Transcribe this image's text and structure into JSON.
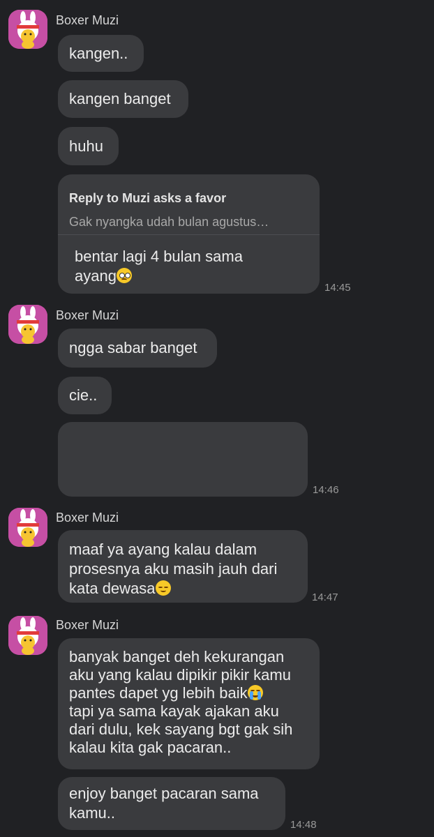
{
  "sender_name": "Boxer Muzi",
  "messages": {
    "m1": "kangen..",
    "m2": "kangen banget",
    "m3": "huhu",
    "reply_title": "Reply to Muzi asks a favor",
    "reply_snippet": "Gak nyangka udah bulan agustus…",
    "m4": "bentar lagi 4 bulan sama\nayang",
    "m5": "ngga sabar banget",
    "m6": "cie..",
    "m8": "maaf ya ayang kalau dalam\nprosesnya aku masih jauh dari\nkata dewasa",
    "m9": "banyak banget deh kekurangan\naku yang kalau dipikir pikir kamu\npantes dapet yg lebih baik",
    "m9b": "tapi ya sama kayak ajakan aku\ndari dulu, kek sayang bgt gak sih\nkalau kita gak pacaran..",
    "m10": "enjoy banget pacaran sama\nkamu.."
  },
  "times": {
    "t1": "14:45",
    "t2": "14:46",
    "t3": "14:47",
    "t4": "14:48"
  },
  "emojis": {
    "pleading": "pleading-face-icon",
    "disappointed": "disappointed-face-icon",
    "crying": "loudly-crying-face-icon"
  },
  "colors": {
    "background": "#202124",
    "bubble": "#3a3b3e",
    "avatar_bg": "#c64fa4"
  }
}
